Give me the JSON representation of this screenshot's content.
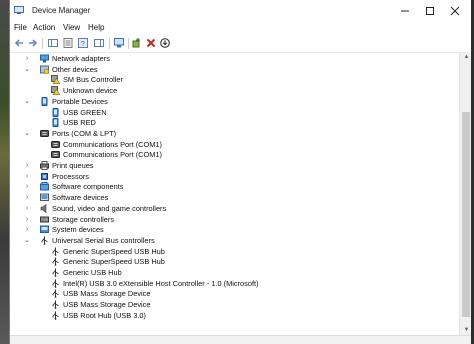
{
  "window": {
    "title": "Device Manager"
  },
  "menu": [
    "File",
    "Action",
    "View",
    "Help"
  ],
  "tree": [
    {
      "label": "Network adapters",
      "level": 0,
      "state": "collapsed",
      "icon": "network-adapter-icon"
    },
    {
      "label": "Other devices",
      "level": 0,
      "state": "expanded",
      "icon": "other-devices-icon"
    },
    {
      "label": "SM Bus Controller",
      "level": 1,
      "icon": "unknown-device-warning-icon"
    },
    {
      "label": "Unknown device",
      "level": 1,
      "icon": "unknown-device-warning-icon"
    },
    {
      "label": "Portable Devices",
      "level": 0,
      "state": "expanded",
      "icon": "portable-device-icon"
    },
    {
      "label": "USB GREEN",
      "level": 1,
      "icon": "portable-device-icon"
    },
    {
      "label": "USB RED",
      "level": 1,
      "icon": "portable-device-icon"
    },
    {
      "label": "Ports (COM & LPT)",
      "level": 0,
      "state": "expanded",
      "icon": "port-icon"
    },
    {
      "label": "Communications Port (COM1)",
      "level": 1,
      "icon": "port-icon"
    },
    {
      "label": "Communications Port (COM1)",
      "level": 1,
      "icon": "port-icon"
    },
    {
      "label": "Print queues",
      "level": 0,
      "state": "collapsed",
      "icon": "printer-icon"
    },
    {
      "label": "Processors",
      "level": 0,
      "state": "collapsed",
      "icon": "processor-icon"
    },
    {
      "label": "Software components",
      "level": 0,
      "state": "collapsed",
      "icon": "software-component-icon"
    },
    {
      "label": "Software devices",
      "level": 0,
      "state": "collapsed",
      "icon": "software-device-icon"
    },
    {
      "label": "Sound, video and game controllers",
      "level": 0,
      "state": "collapsed",
      "icon": "speaker-icon"
    },
    {
      "label": "Storage controllers",
      "level": 0,
      "state": "collapsed",
      "icon": "storage-controller-icon"
    },
    {
      "label": "System devices",
      "level": 0,
      "state": "collapsed",
      "icon": "system-device-icon"
    },
    {
      "label": "Universal Serial Bus controllers",
      "level": 0,
      "state": "expanded",
      "icon": "usb-icon"
    },
    {
      "label": "Generic SuperSpeed USB Hub",
      "level": 1,
      "icon": "usb-icon"
    },
    {
      "label": "Generic SuperSpeed USB Hub",
      "level": 1,
      "icon": "usb-icon"
    },
    {
      "label": "Generic USB Hub",
      "level": 1,
      "icon": "usb-icon"
    },
    {
      "label": "Intel(R) USB 3.0 eXtensible Host Controller - 1.0 (Microsoft)",
      "level": 1,
      "icon": "usb-icon"
    },
    {
      "label": "USB Mass Storage Device",
      "level": 1,
      "icon": "usb-icon"
    },
    {
      "label": "USB Mass Storage Device",
      "level": 1,
      "icon": "usb-icon"
    },
    {
      "label": "USB Root Hub (USB 3.0)",
      "level": 1,
      "icon": "usb-icon"
    }
  ]
}
